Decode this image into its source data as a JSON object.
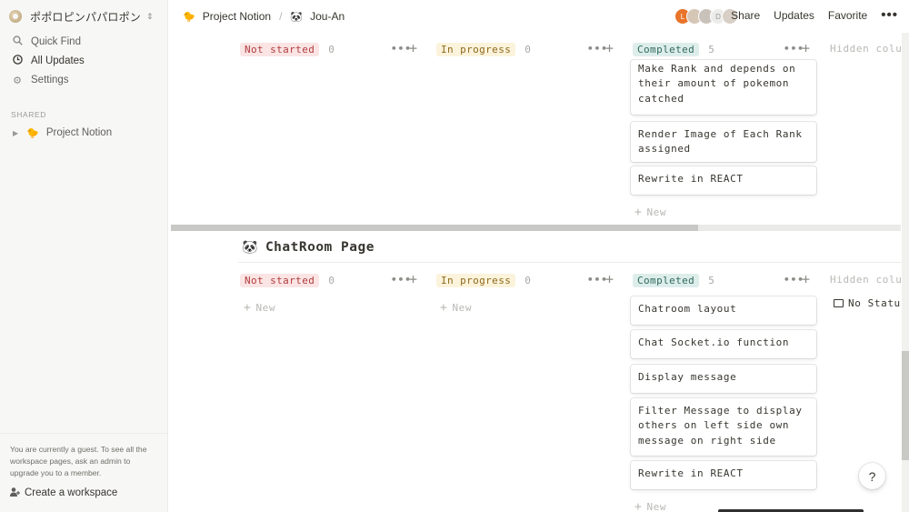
{
  "sidebar": {
    "workspace_name": "ポポロピンパパロポン",
    "workspace_chevron": "⌃⌄",
    "nav": [
      {
        "label": "Quick Find",
        "icon": "search-icon"
      },
      {
        "label": "All Updates",
        "icon": "clock-icon"
      },
      {
        "label": "Settings",
        "icon": "gear-icon"
      }
    ],
    "shared_label": "SHARED",
    "shared_items": [
      {
        "label": "Project Notion",
        "emoji": "🐤"
      }
    ],
    "guest_note": "You are currently a guest. To see all the workspace pages, ask an admin to upgrade you to a member.",
    "create_workspace": "Create a workspace"
  },
  "topbar": {
    "breadcrumb": [
      {
        "label": "Project Notion",
        "emoji": "🐤"
      },
      {
        "label": "Jou-An",
        "emoji": "🐼"
      }
    ],
    "breadcrumb_sep": "/",
    "avatars": [
      {
        "initial": "L",
        "color": "#e8742a"
      },
      {
        "initial": "",
        "color": "#d6c6b6"
      },
      {
        "initial": "",
        "color": "#c9c2bb"
      },
      {
        "initial": "D",
        "color": "#e6e6e4"
      },
      {
        "initial": "",
        "color": "#d8cfc6"
      }
    ],
    "share": "Share",
    "updates": "Updates",
    "favorite": "Favorite",
    "more": "•••"
  },
  "board_top": {
    "groups": [
      {
        "status": "Not started",
        "count": "0"
      },
      {
        "status": "In progress",
        "count": "0"
      },
      {
        "status": "Completed",
        "count": "5"
      }
    ],
    "hidden_columns": "Hidden colu",
    "cards": [
      "Make Rank and depends on their amount of pokemon catched",
      "Render Image of Each Rank assigned",
      "Rewrite in REACT"
    ],
    "new_label": "New"
  },
  "section": {
    "emoji": "🐼",
    "title": "ChatRoom Page"
  },
  "board_bottom": {
    "groups": [
      {
        "status": "Not started",
        "count": "0"
      },
      {
        "status": "In progress",
        "count": "0"
      },
      {
        "status": "Completed",
        "count": "5"
      }
    ],
    "hidden_columns": "Hidden colu",
    "no_status": "No Statu",
    "cards": [
      "Chatroom layout",
      "Chat Socket.io function",
      "Display message",
      "Filter Message to display others on left side own message on right side",
      "Rewrite in REACT"
    ],
    "new_label": "New"
  },
  "help": "?"
}
